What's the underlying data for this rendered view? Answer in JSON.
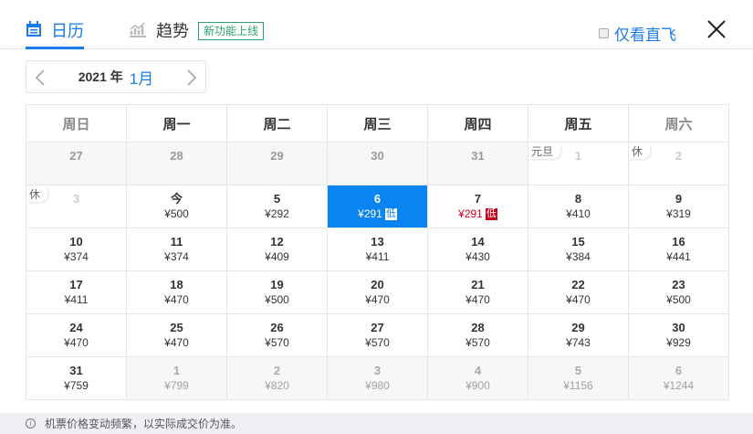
{
  "tabs": [
    {
      "label": "日历",
      "active": true
    },
    {
      "label": "趋势",
      "badge": "新功能上线"
    }
  ],
  "direct_only": {
    "label": "仅看直飞",
    "checked": false
  },
  "month_nav": {
    "year": "2021 年",
    "month": "1月"
  },
  "weekdays": [
    "周日",
    "周一",
    "周二",
    "周三",
    "周四",
    "周五",
    "周六"
  ],
  "rows": [
    [
      {
        "d": "27",
        "t": "prev"
      },
      {
        "d": "28",
        "t": "prev"
      },
      {
        "d": "29",
        "t": "prev"
      },
      {
        "d": "30",
        "t": "prev"
      },
      {
        "d": "31",
        "t": "prev"
      },
      {
        "d": "1",
        "t": "off",
        "tag": "元旦"
      },
      {
        "d": "2",
        "t": "off",
        "tag": "休"
      }
    ],
    [
      {
        "d": "3",
        "t": "off",
        "tag": "休"
      },
      {
        "d": "今",
        "p": "¥500"
      },
      {
        "d": "5",
        "p": "¥292"
      },
      {
        "d": "6",
        "p": "¥291",
        "t": "sel",
        "low": "低"
      },
      {
        "d": "7",
        "p": "¥291",
        "t": "low",
        "low": "低"
      },
      {
        "d": "8",
        "p": "¥410"
      },
      {
        "d": "9",
        "p": "¥319"
      }
    ],
    [
      {
        "d": "10",
        "p": "¥374"
      },
      {
        "d": "11",
        "p": "¥374"
      },
      {
        "d": "12",
        "p": "¥409"
      },
      {
        "d": "13",
        "p": "¥411"
      },
      {
        "d": "14",
        "p": "¥430"
      },
      {
        "d": "15",
        "p": "¥384"
      },
      {
        "d": "16",
        "p": "¥441"
      }
    ],
    [
      {
        "d": "17",
        "p": "¥411"
      },
      {
        "d": "18",
        "p": "¥470"
      },
      {
        "d": "19",
        "p": "¥500"
      },
      {
        "d": "20",
        "p": "¥470"
      },
      {
        "d": "21",
        "p": "¥470"
      },
      {
        "d": "22",
        "p": "¥470"
      },
      {
        "d": "23",
        "p": "¥500"
      }
    ],
    [
      {
        "d": "24",
        "p": "¥470"
      },
      {
        "d": "25",
        "p": "¥470"
      },
      {
        "d": "26",
        "p": "¥570"
      },
      {
        "d": "27",
        "p": "¥570"
      },
      {
        "d": "28",
        "p": "¥570"
      },
      {
        "d": "29",
        "p": "¥743"
      },
      {
        "d": "30",
        "p": "¥929"
      }
    ],
    [
      {
        "d": "31",
        "p": "¥759"
      },
      {
        "d": "1",
        "p": "¥799",
        "t": "next"
      },
      {
        "d": "2",
        "p": "¥820",
        "t": "next"
      },
      {
        "d": "3",
        "p": "¥980",
        "t": "next"
      },
      {
        "d": "4",
        "p": "¥900",
        "t": "next"
      },
      {
        "d": "5",
        "p": "¥1156",
        "t": "next"
      },
      {
        "d": "6",
        "p": "¥1244",
        "t": "next"
      }
    ]
  ],
  "footer": {
    "text": "机票价格变动频繁，以实际成交价为准。"
  },
  "colors": {
    "accent": "#1a7ce6",
    "selected": "#0a84f0",
    "low": "#d0021b",
    "badge": "#2aa26a"
  }
}
